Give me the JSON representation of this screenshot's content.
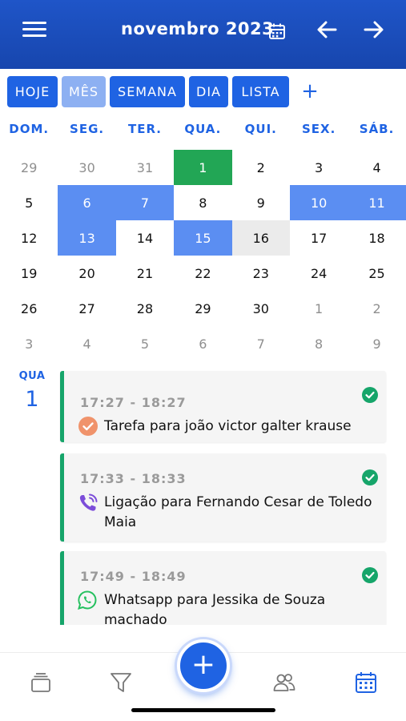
{
  "header": {
    "title": "novembro 2023",
    "background_color": "#1f55c8"
  },
  "tabs": {
    "items": [
      "HOJE",
      "MÊS",
      "SEMANA",
      "DIA",
      "LISTA"
    ],
    "active": "MÊS",
    "add_label": "+"
  },
  "calendar": {
    "weekdays": [
      "DOM.",
      "SEG.",
      "TER.",
      "QUA.",
      "QUI.",
      "SEX.",
      "SÁB."
    ],
    "weeks": [
      [
        "29",
        "30",
        "31",
        "1",
        "2",
        "3",
        "4"
      ],
      [
        "5",
        "6",
        "7",
        "8",
        "9",
        "10",
        "11"
      ],
      [
        "12",
        "13",
        "14",
        "15",
        "16",
        "17",
        "18"
      ],
      [
        "19",
        "20",
        "21",
        "22",
        "23",
        "24",
        "25"
      ],
      [
        "26",
        "27",
        "28",
        "29",
        "30",
        "1",
        "2"
      ],
      [
        "3",
        "4",
        "5",
        "6",
        "7",
        "8",
        "9"
      ]
    ],
    "today_color": "#22a655",
    "selected_color": "#5b8ef2"
  },
  "day": {
    "weekday": "QUA",
    "number": "1"
  },
  "events": [
    {
      "time": "17:27 - 18:27",
      "title": "Tarefa para joão victor galter krause",
      "icon": "task-check-icon",
      "done": true
    },
    {
      "time": "17:33 - 18:33",
      "title": "Ligação para Fernando Cesar de Toledo Maia",
      "icon": "phone-call-icon",
      "done": true
    },
    {
      "time": "17:49 - 18:49",
      "title": "Whatsapp para Jessika de Souza machado",
      "icon": "whatsapp-icon",
      "done": true
    }
  ],
  "bottom_nav": {
    "items": [
      "inbox-tray-icon",
      "filter-funnel-icon",
      "people-icon",
      "calendar-icon"
    ],
    "fab_label": "+"
  },
  "colors": {
    "primary": "#1f63e3",
    "event_accent": "#16a56a"
  }
}
